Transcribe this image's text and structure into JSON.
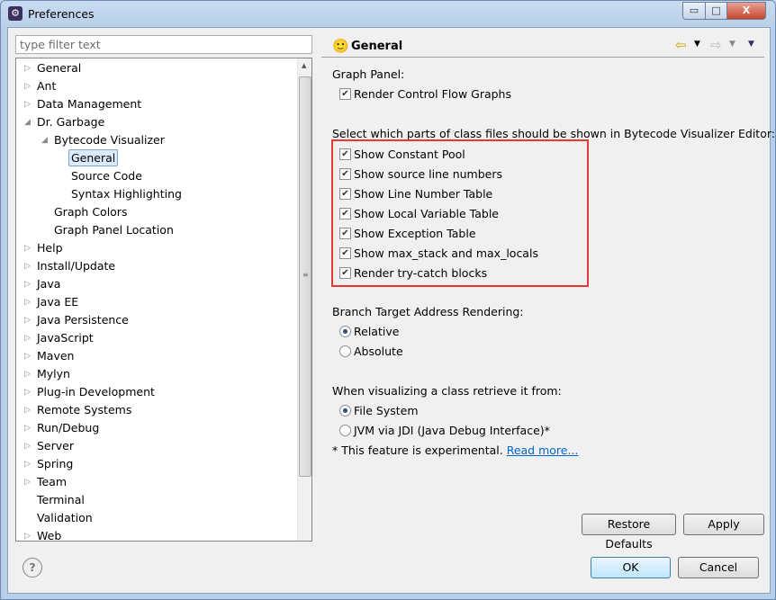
{
  "window": {
    "title": "Preferences",
    "minimize": "▭",
    "maximize": "□",
    "close": "X"
  },
  "filter": {
    "placeholder": "type filter text"
  },
  "tree": [
    {
      "label": "General",
      "level": 0,
      "twisty": "closed"
    },
    {
      "label": "Ant",
      "level": 0,
      "twisty": "closed"
    },
    {
      "label": "Data Management",
      "level": 0,
      "twisty": "closed"
    },
    {
      "label": "Dr. Garbage",
      "level": 0,
      "twisty": "open"
    },
    {
      "label": "Bytecode Visualizer",
      "level": 1,
      "twisty": "open"
    },
    {
      "label": "General",
      "level": 2,
      "twisty": "none",
      "selected": true
    },
    {
      "label": "Source Code",
      "level": 2,
      "twisty": "none"
    },
    {
      "label": "Syntax Highlighting",
      "level": 2,
      "twisty": "none"
    },
    {
      "label": "Graph Colors",
      "level": 1,
      "twisty": "none"
    },
    {
      "label": "Graph Panel Location",
      "level": 1,
      "twisty": "none"
    },
    {
      "label": "Help",
      "level": 0,
      "twisty": "closed"
    },
    {
      "label": "Install/Update",
      "level": 0,
      "twisty": "closed"
    },
    {
      "label": "Java",
      "level": 0,
      "twisty": "closed"
    },
    {
      "label": "Java EE",
      "level": 0,
      "twisty": "closed"
    },
    {
      "label": "Java Persistence",
      "level": 0,
      "twisty": "closed"
    },
    {
      "label": "JavaScript",
      "level": 0,
      "twisty": "closed"
    },
    {
      "label": "Maven",
      "level": 0,
      "twisty": "closed"
    },
    {
      "label": "Mylyn",
      "level": 0,
      "twisty": "closed"
    },
    {
      "label": "Plug-in Development",
      "level": 0,
      "twisty": "closed"
    },
    {
      "label": "Remote Systems",
      "level": 0,
      "twisty": "closed"
    },
    {
      "label": "Run/Debug",
      "level": 0,
      "twisty": "closed"
    },
    {
      "label": "Server",
      "level": 0,
      "twisty": "closed"
    },
    {
      "label": "Spring",
      "level": 0,
      "twisty": "closed"
    },
    {
      "label": "Team",
      "level": 0,
      "twisty": "closed"
    },
    {
      "label": "Terminal",
      "level": 0,
      "twisty": "none"
    },
    {
      "label": "Validation",
      "level": 0,
      "twisty": "none"
    },
    {
      "label": "Web",
      "level": 0,
      "twisty": "closed"
    }
  ],
  "page": {
    "title": "General",
    "graph_panel_label": "Graph Panel:",
    "render_cfg": {
      "label": "Render Control Flow Graphs",
      "checked": true
    },
    "class_parts_label": "Select which parts of class files should be shown in Bytecode Visualizer Editor:",
    "class_parts": [
      {
        "label": "Show Constant Pool",
        "checked": true
      },
      {
        "label": "Show source line numbers",
        "checked": true
      },
      {
        "label": "Show Line Number Table",
        "checked": true
      },
      {
        "label": "Show Local Variable Table",
        "checked": true
      },
      {
        "label": "Show Exception Table",
        "checked": true
      },
      {
        "label": "Show max_stack and max_locals",
        "checked": true
      },
      {
        "label": "Render try-catch blocks",
        "checked": true
      }
    ],
    "branch_label": "Branch Target Address Rendering:",
    "branch_options": [
      {
        "label": "Relative",
        "selected": true
      },
      {
        "label": "Absolute",
        "selected": false
      }
    ],
    "retrieve_label": "When visualizing a class retrieve it from:",
    "retrieve_options": [
      {
        "label": "File System",
        "selected": true
      },
      {
        "label": "JVM via JDI (Java Debug Interface)*",
        "selected": false
      }
    ],
    "note": "* This feature is experimental.",
    "read_more": "Read more...",
    "restore_defaults": "Restore Defaults",
    "apply": "Apply"
  },
  "footer": {
    "help": "?",
    "ok": "OK",
    "cancel": "Cancel"
  },
  "highlight_color": "#e53935"
}
